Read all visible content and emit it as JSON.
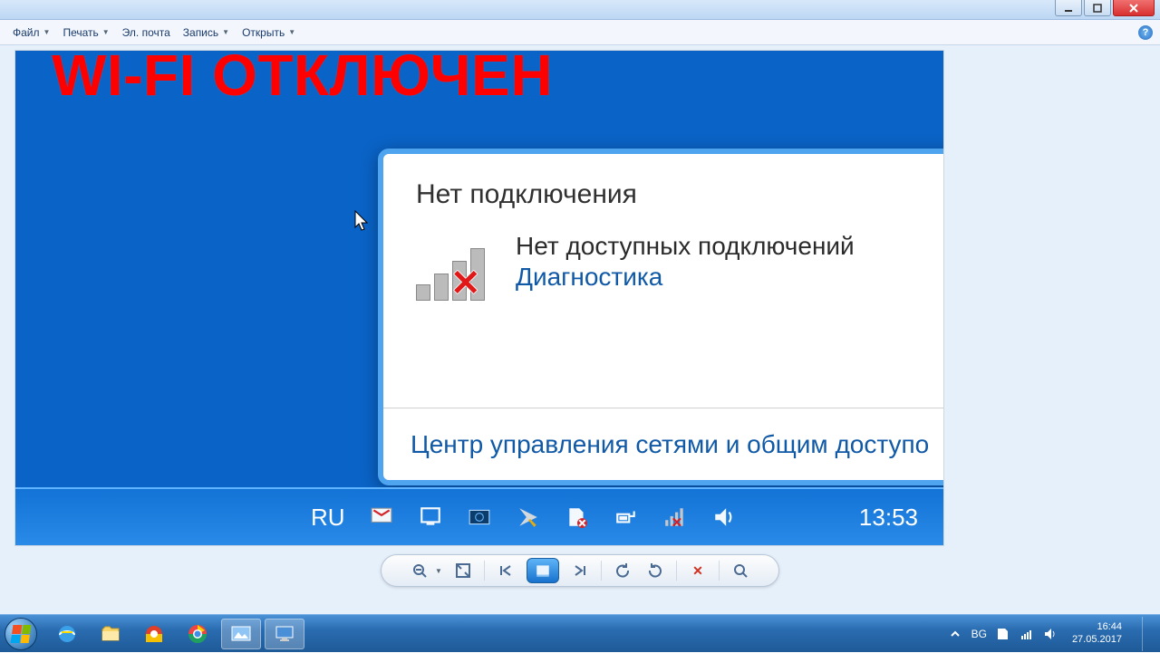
{
  "outer_menu": {
    "file": "Файл",
    "print": "Печать",
    "email": "Эл. почта",
    "burn": "Запись",
    "open": "Открыть"
  },
  "overlay_title": "WI-FI ОТКЛЮЧЕН",
  "popup": {
    "title": "Нет подключения",
    "no_available": "Нет доступных подключений",
    "diagnose": "Диагностика",
    "network_center": "Центр управления сетями и общим доступо"
  },
  "inner_taskbar": {
    "lang": "RU",
    "clock": "13:53"
  },
  "outer_taskbar": {
    "lang": "BG",
    "clock_time": "16:44",
    "clock_date": "27.05.2017"
  }
}
